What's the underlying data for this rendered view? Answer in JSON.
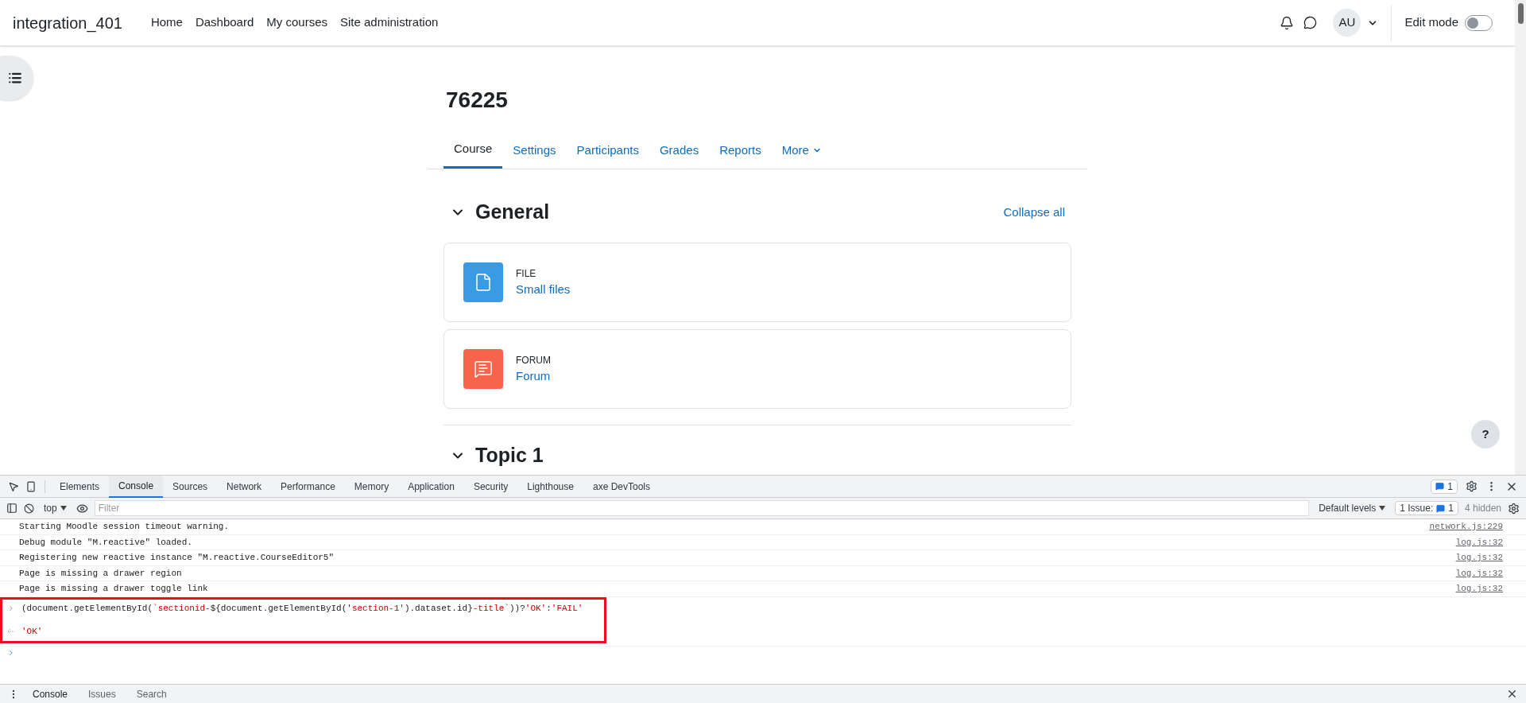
{
  "navbar": {
    "brand": "integration_401",
    "links": [
      "Home",
      "Dashboard",
      "My courses",
      "Site administration"
    ],
    "avatar": "AU",
    "edit_mode": {
      "label": "Edit mode",
      "on": false
    }
  },
  "course": {
    "title": "76225",
    "tabs": [
      {
        "label": "Course",
        "selected": true,
        "kind": "link"
      },
      {
        "label": "Settings",
        "selected": false,
        "kind": "link"
      },
      {
        "label": "Participants",
        "selected": false,
        "kind": "link"
      },
      {
        "label": "Grades",
        "selected": false,
        "kind": "link"
      },
      {
        "label": "Reports",
        "selected": false,
        "kind": "link"
      },
      {
        "label": "More",
        "selected": false,
        "kind": "menu"
      }
    ],
    "sections": [
      {
        "title": "General",
        "expanded": true,
        "action": "Collapse all",
        "activities": [
          {
            "kind": "file",
            "type_label": "FILE",
            "name": "Small files"
          },
          {
            "kind": "forum",
            "type_label": "FORUM",
            "name": "Forum"
          }
        ]
      },
      {
        "title": "Topic 1",
        "expanded": true
      }
    ]
  },
  "help_button": "?",
  "devtools": {
    "tabs": [
      {
        "label": "Elements",
        "selected": false
      },
      {
        "label": "Console",
        "selected": true
      },
      {
        "label": "Sources",
        "selected": false
      },
      {
        "label": "Network",
        "selected": false
      },
      {
        "label": "Performance",
        "selected": false
      },
      {
        "label": "Memory",
        "selected": false
      },
      {
        "label": "Application",
        "selected": false
      },
      {
        "label": "Security",
        "selected": false
      },
      {
        "label": "Lighthouse",
        "selected": false
      },
      {
        "label": "axe DevTools",
        "selected": false
      }
    ],
    "issues_badge": "1",
    "toolbar": {
      "context": "top",
      "filter_placeholder": "Filter",
      "levels": "Default levels",
      "issues_label": "1 Issue:",
      "issues_count": "1",
      "hidden": "4 hidden"
    },
    "messages": [
      {
        "text": "Starting Moodle session timeout warning.",
        "source": "network.js:229"
      },
      {
        "text": "Debug module \"M.reactive\" loaded.",
        "source": "log.js:32"
      },
      {
        "text": "Registering new reactive instance \"M.reactive.CourseEditor5\"",
        "source": "log.js:32"
      },
      {
        "text": "Page is missing a drawer region",
        "source": "log.js:32"
      },
      {
        "text": "Page is missing a drawer toggle link",
        "source": "log.js:32"
      }
    ],
    "command": [
      {
        "text": "(document.getElementById(",
        "kind": "code"
      },
      {
        "text": "`sectionid-",
        "kind": "string"
      },
      {
        "text": "${document.getElementById(",
        "kind": "code"
      },
      {
        "text": "'section-1'",
        "kind": "string"
      },
      {
        "text": ").dataset.id}",
        "kind": "code"
      },
      {
        "text": "-title`",
        "kind": "string"
      },
      {
        "text": "))?",
        "kind": "code"
      },
      {
        "text": "'OK'",
        "kind": "string"
      },
      {
        "text": ":",
        "kind": "code"
      },
      {
        "text": "'FAIL'",
        "kind": "string"
      }
    ],
    "result": "'OK'",
    "drawer_tabs": [
      {
        "label": "Console",
        "selected": true
      },
      {
        "label": "Issues",
        "selected": false
      },
      {
        "label": "Search",
        "selected": false
      }
    ]
  }
}
